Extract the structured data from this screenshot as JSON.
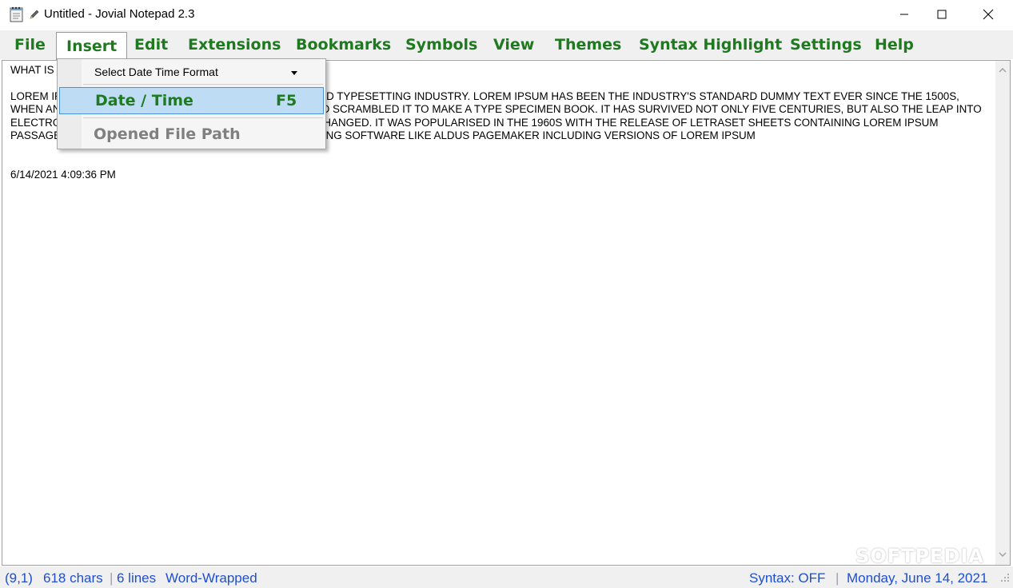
{
  "window": {
    "title": "Untitled - Jovial Notepad 2.3",
    "icons": [
      "notepad-icon",
      "pencil-icon",
      "minimize-icon",
      "maximize-icon",
      "close-icon"
    ]
  },
  "menu": {
    "file": "File",
    "insert": "Insert",
    "edit": "Edit",
    "extensions": "Extensions",
    "bookmarks": "Bookmarks",
    "symbols": "Symbols",
    "view": "View",
    "themes": "Themes",
    "syntax_highlight": "Syntax Highlight",
    "settings": "Settings",
    "help": "Help"
  },
  "dropdown": {
    "select_format": "Select Date Time Format",
    "date_time_label": "Date / Time",
    "date_time_shortcut": "F5",
    "opened_file_path": "Opened File Path"
  },
  "editor": {
    "text": "WHAT IS LOREM IPSUM?\n\nLOREM IPSUM IS SIMPLY DUMMY TEXT OF THE PRINTING AND TYPESETTING INDUSTRY. LOREM IPSUM HAS BEEN THE INDUSTRY'S STANDARD DUMMY TEXT EVER SINCE THE 1500S, WHEN AN UNKNOWN PRINTER TOOK A GALLEY OF TYPE AND SCRAMBLED IT TO MAKE A TYPE SPECIMEN BOOK. IT HAS SURVIVED NOT ONLY FIVE CENTURIES, BUT ALSO THE LEAP INTO ELECTRONIC TYPESETTING, REMAINING ESSENTIALLY UNCHANGED. IT WAS POPULARISED IN THE 1960S WITH THE RELEASE OF LETRASET SHEETS CONTAINING LOREM IPSUM PASSAGES, AND MORE RECENTLY WITH DESKTOP PUBLISHING SOFTWARE LIKE ALDUS PAGEMAKER INCLUDING VERSIONS OF LOREM IPSUM\n\n\n6/14/2021 4:09:36 PM"
  },
  "status": {
    "position": "(9,1)",
    "chars": "618 chars",
    "lines": "6 lines",
    "wrap": "Word-Wrapped",
    "syntax": "Syntax: OFF",
    "date": "Monday, June 14, 2021"
  },
  "watermark": "SOFTPEDIA",
  "colors": {
    "menu_text": "#1e7a1e",
    "status_text": "#1f4fd0",
    "highlight_bg": "#bfdcf5",
    "highlight_border": "#4c93d6"
  }
}
